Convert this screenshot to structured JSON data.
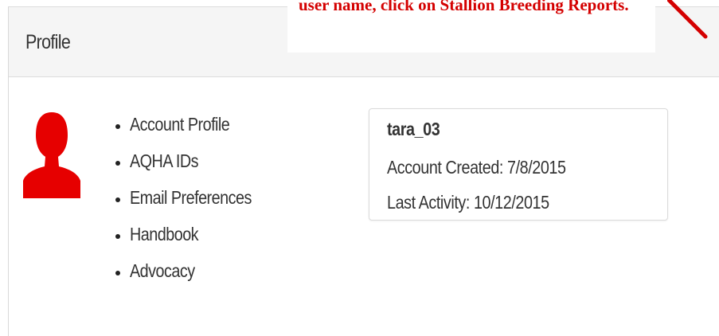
{
  "annotation": {
    "text": "user name, click on Stallion Breeding Reports.",
    "color": "#d40000"
  },
  "panel": {
    "title": "Profile"
  },
  "avatar": {
    "icon": "user-silhouette-icon",
    "color": "#e60000"
  },
  "nav": {
    "items": [
      {
        "label": "Account Profile"
      },
      {
        "label": "AQHA IDs"
      },
      {
        "label": "Email Preferences"
      },
      {
        "label": "Handbook"
      },
      {
        "label": "Advocacy"
      }
    ]
  },
  "account": {
    "username": "tara_03",
    "created": "Account Created: 7/8/2015",
    "last_activity": "Last Activity: 10/12/2015"
  }
}
